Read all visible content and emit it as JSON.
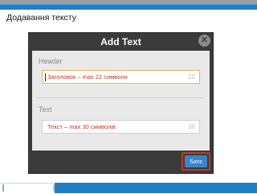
{
  "page": {
    "caption": "Додавання тексту"
  },
  "dialog": {
    "title": "Add Text",
    "close_label": "✕",
    "header_section": {
      "label": "Header",
      "placeholder": "Заголовок – max 22 символи",
      "counter": "22"
    },
    "text_section": {
      "label": "Text",
      "placeholder": "Текст – max 30 символів",
      "counter": "30"
    },
    "save_label": "Save"
  }
}
